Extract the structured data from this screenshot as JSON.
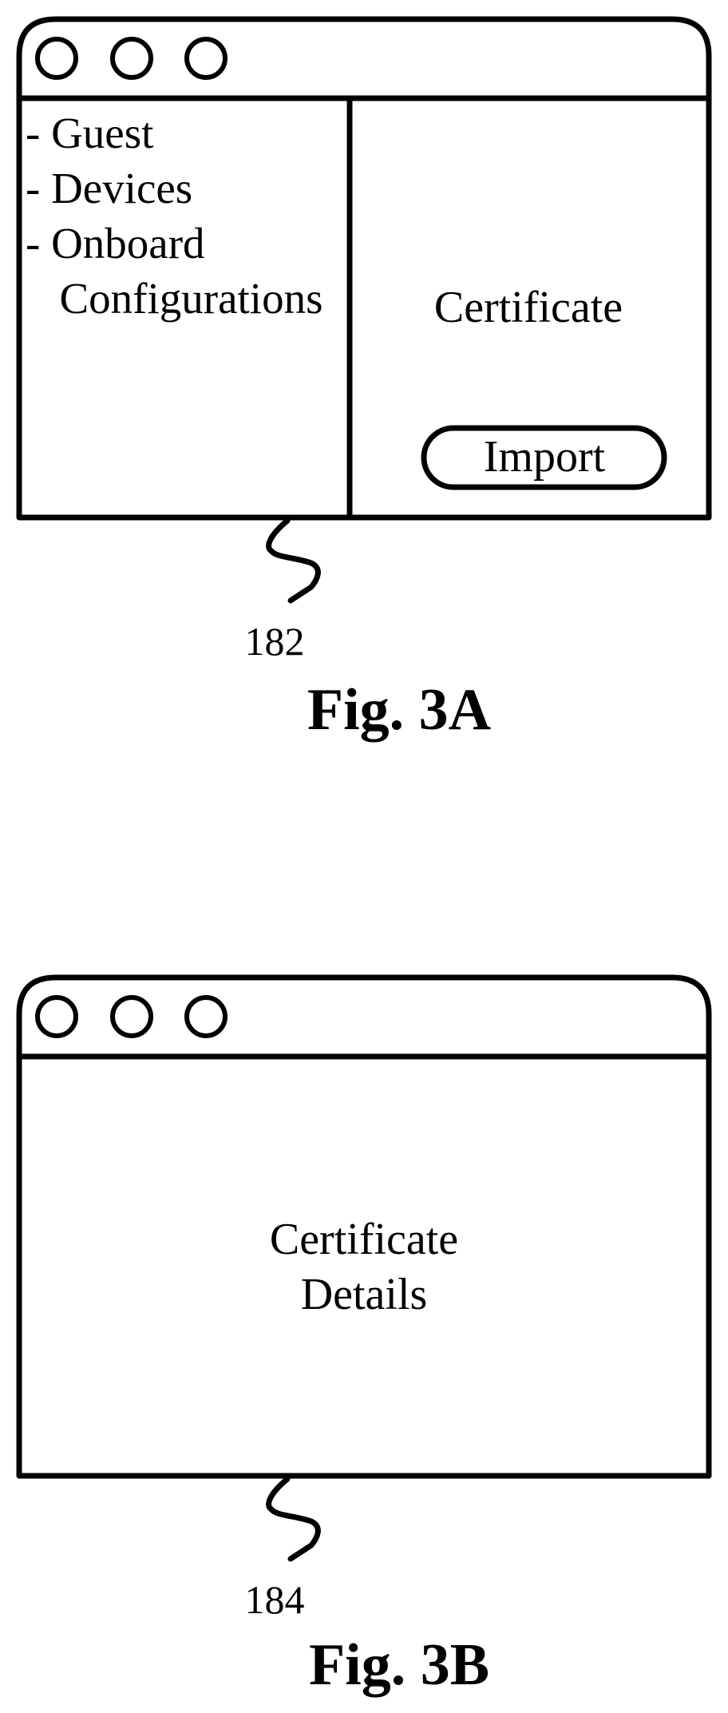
{
  "figures": [
    {
      "id": "fig3a",
      "caption": "Fig. 3A",
      "reference_number": "182",
      "window": {
        "title_bar_buttons": [
          "window-control-circle",
          "window-control-circle",
          "window-control-circle"
        ],
        "sidebar": {
          "items": [
            {
              "label": "- Guest"
            },
            {
              "label": "- Devices"
            },
            {
              "label": "- Onboard"
            },
            {
              "label": "  Configurations"
            }
          ]
        },
        "main": {
          "heading": "Certificate",
          "import_button_label": "Import"
        }
      }
    },
    {
      "id": "fig3b",
      "caption": "Fig. 3B",
      "reference_number": "184",
      "window": {
        "title_bar_buttons": [
          "window-control-circle",
          "window-control-circle",
          "window-control-circle"
        ],
        "main": {
          "lines": [
            "Certificate",
            "Details"
          ]
        }
      }
    }
  ]
}
